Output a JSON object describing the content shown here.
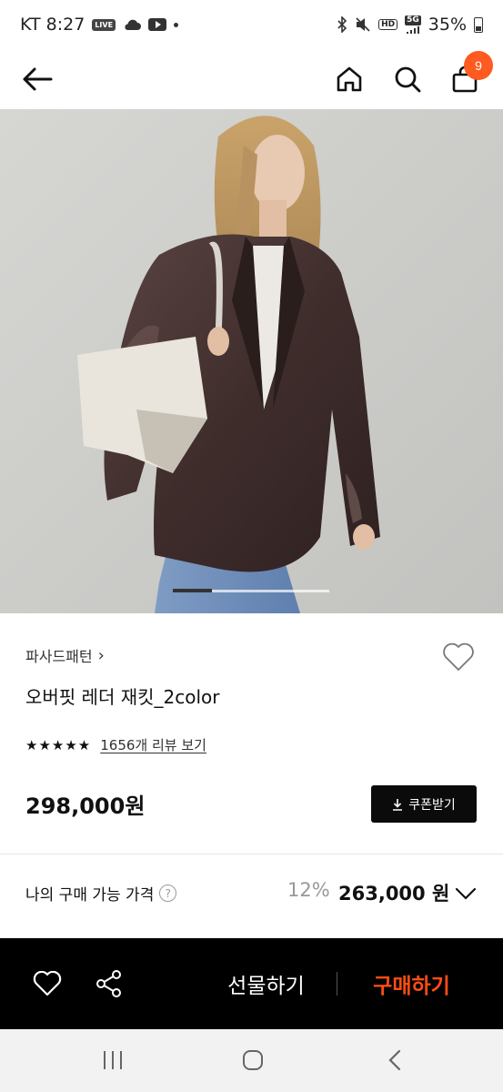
{
  "status_bar": {
    "carrier_time": "KT 8:27",
    "live_label": "LIVE",
    "hd_label": "HD",
    "network_label": "5G",
    "battery": "35%"
  },
  "header": {
    "cart_count": "9"
  },
  "hero": {
    "slide_progress": 0.25
  },
  "product": {
    "brand": "파사드패턴",
    "brand_chevron": "›",
    "title": "오버핏 레더 재킷_2color",
    "stars": "★★★★★",
    "review_link": "1656개 리뷰 보기",
    "price": "298,000원",
    "coupon_label": "쿠폰받기"
  },
  "my_price": {
    "label": "나의 구매 가능 가격",
    "help": "?",
    "discount": "12%",
    "price": "263,000 원"
  },
  "action_bar": {
    "gift_label": "선물하기",
    "buy_label": "구매하기"
  },
  "colors": {
    "accent": "#ff4d12",
    "badge": "#ff5a1f",
    "action_bar_bg": "#000000"
  }
}
